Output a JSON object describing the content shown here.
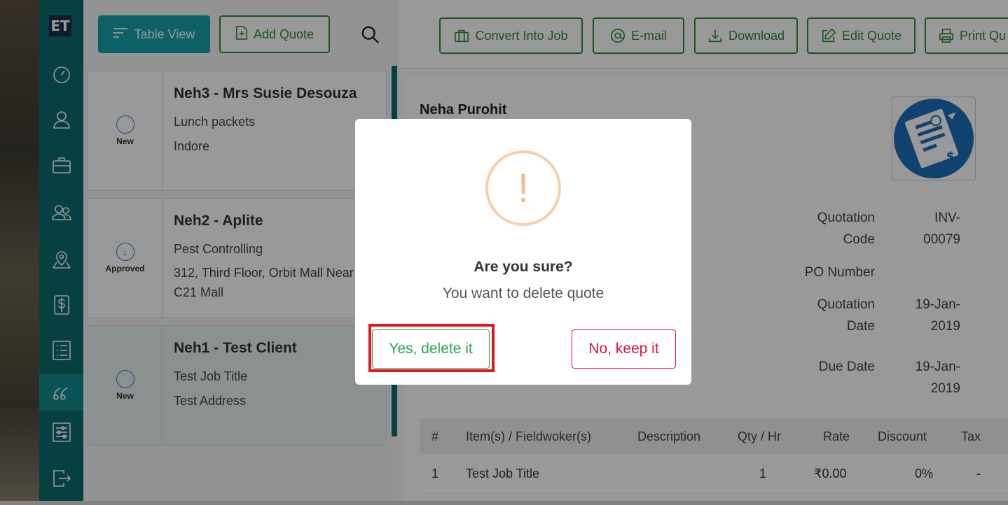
{
  "sidebar": {
    "logo": "ET",
    "items": [
      {
        "icon": "dashboard-icon"
      },
      {
        "icon": "user-icon"
      },
      {
        "icon": "briefcase-icon"
      },
      {
        "icon": "users-icon"
      },
      {
        "icon": "map-pin-icon"
      },
      {
        "icon": "dollar-icon"
      },
      {
        "icon": "list-icon"
      },
      {
        "icon": "quote-icon",
        "active": true
      },
      {
        "icon": "settings-sliders-icon"
      },
      {
        "icon": "logout-icon"
      }
    ]
  },
  "list_panel": {
    "table_view_label": "Table View",
    "add_quote_label": "Add Quote",
    "quotes": [
      {
        "status": "New",
        "title": "Neh3 - Mrs Susie Desouza",
        "job": "Lunch packets",
        "address": "Indore"
      },
      {
        "status": "Approved",
        "title": "Neh2 - Aplite",
        "job": "Pest Controlling",
        "address": "312, Third Floor, Orbit Mall Near C21 Mall"
      },
      {
        "status": "New",
        "title": "Neh1 - Test Client",
        "job": "Test Job Title",
        "address": "Test Address"
      }
    ]
  },
  "toolbar": {
    "convert_label": "Convert Into Job",
    "email_label": "E-mail",
    "download_label": "Download",
    "edit_label": "Edit Quote",
    "print_label": "Print Qu"
  },
  "detail": {
    "client_name": "Neha Purohit",
    "meta": {
      "quotation_code_label_1": "Quotation",
      "quotation_code_label_2": "Code",
      "quotation_code_value_1": "INV-",
      "quotation_code_value_2": "00079",
      "po_number_label": "PO Number",
      "quotation_date_label_1": "Quotation",
      "quotation_date_label_2": "Date",
      "quotation_date_value_1": "19-Jan-",
      "quotation_date_value_2": "2019",
      "due_date_label": "Due Date",
      "due_date_value_1": "19-Jan-",
      "due_date_value_2": "2019"
    },
    "table": {
      "headers": [
        "#",
        "Item(s) / Fieldwoker(s)",
        "Description",
        "Qty / Hr",
        "Rate",
        "Discount",
        "Tax"
      ],
      "rows": [
        [
          "1",
          "Test Job Title",
          "",
          "1",
          "₹0.00",
          "0%",
          "-"
        ]
      ]
    }
  },
  "dialog": {
    "icon": "exclamation",
    "title": "Are you sure?",
    "text": "You want to delete quote",
    "confirm_label": "Yes, delete it",
    "cancel_label": "No, keep it"
  },
  "colors": {
    "sidebar": "#0d6b70",
    "primary": "#17a0a8",
    "green": "#2e8b3a",
    "confirm": "#28a745",
    "cancel": "#dc143c",
    "warning": "#f8bb86",
    "highlight": "#e8141b"
  }
}
